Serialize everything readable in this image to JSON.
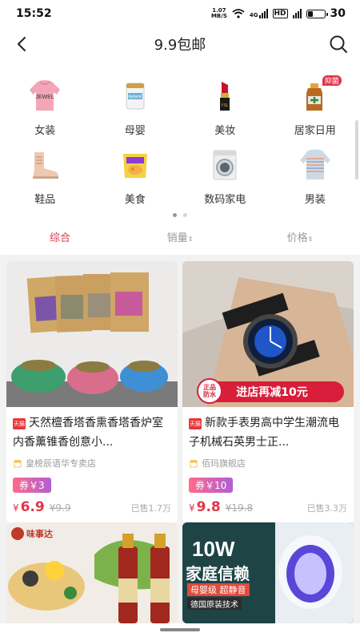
{
  "status_bar": {
    "time": "15:52",
    "net_speed_top": "1.07",
    "net_speed_bottom": "MB/S",
    "signal_label": "4G",
    "hd_label": "HD",
    "battery_percent": "30",
    "battery_level": 0.3
  },
  "header": {
    "title": "9.9包邮"
  },
  "categories": [
    {
      "label": "女装",
      "icon": "sweater-icon"
    },
    {
      "label": "母婴",
      "icon": "milk-powder-icon"
    },
    {
      "label": "美妆",
      "icon": "lipstick-icon"
    },
    {
      "label": "居家日用",
      "icon": "disinfectant-icon",
      "badge": "抑菌"
    },
    {
      "label": "鞋品",
      "icon": "boot-icon"
    },
    {
      "label": "美食",
      "icon": "snack-icon"
    },
    {
      "label": "数码家电",
      "icon": "washing-machine-icon"
    },
    {
      "label": "男装",
      "icon": "knit-sweater-icon"
    }
  ],
  "sort_tabs": [
    {
      "label": "综合",
      "arrow": ""
    },
    {
      "label": "销量",
      "arrow": "⇕"
    },
    {
      "label": "价格",
      "arrow": "⇕"
    }
  ],
  "products": [
    {
      "badge": "天猫",
      "title": "天然檀香塔香熏香塔香炉室内香薰锥香创意小...",
      "shop": "皇榜辰语华专卖店",
      "coupon": "券￥3",
      "currency": "¥",
      "price": "6.9",
      "original_price": "¥9.9",
      "sold": "已售1.7万"
    },
    {
      "badge": "天猫",
      "title": "新款手表男高中学生潮流电子机械石英男士正...",
      "shop": "佰玛旗舰店",
      "coupon": "券￥10",
      "currency": "¥",
      "price": "9.8",
      "original_price": "¥19.8",
      "sold": "已售3.3万",
      "banner_text": "进店再减10元",
      "seal_text_1": "正品",
      "seal_text_2": "防水"
    },
    {
      "brand_logo": "味事达"
    },
    {
      "ad_title": "10W",
      "ad_subtitle": "家庭信赖",
      "ad_line": "母婴级  超静音",
      "ad_line2": "德国原装技术"
    }
  ],
  "colors": {
    "accent": "#e0364a",
    "coupon_start": "#ff6a8a",
    "coupon_end": "#b05fd6"
  }
}
